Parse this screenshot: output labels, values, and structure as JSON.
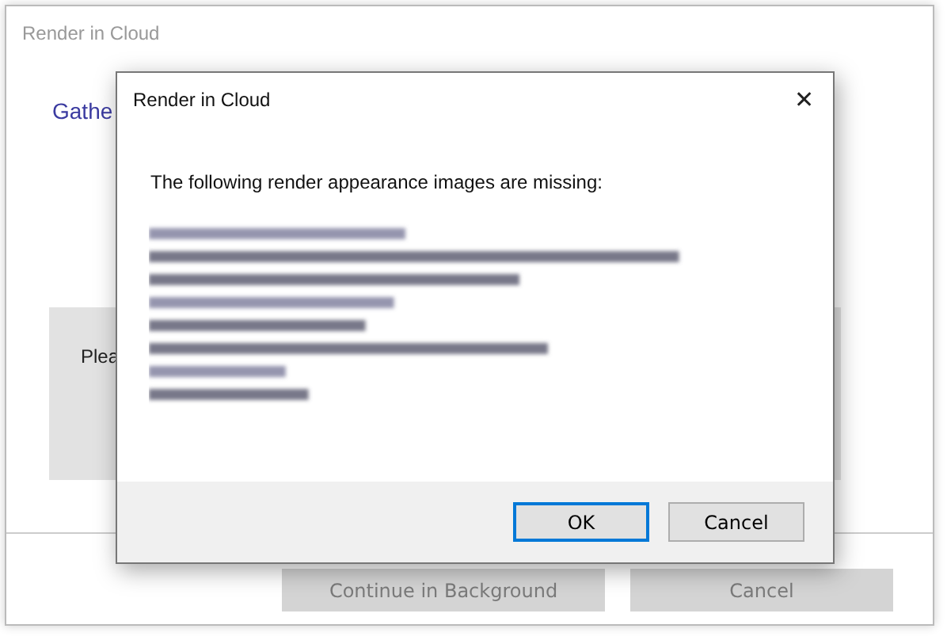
{
  "back_window": {
    "title": "Render in Cloud",
    "heading": "Gathe",
    "panel_text": "Plea",
    "buttons": [
      {
        "label": "Continue in Background",
        "disabled": true
      },
      {
        "label": "Cancel",
        "disabled": true
      }
    ]
  },
  "dialog": {
    "title": "Render in Cloud",
    "close": "✕",
    "message": "The following render appearance images are missing:",
    "buttons": [
      {
        "label": "OK",
        "focused": true
      },
      {
        "label": "Cancel",
        "focused": false
      }
    ]
  }
}
